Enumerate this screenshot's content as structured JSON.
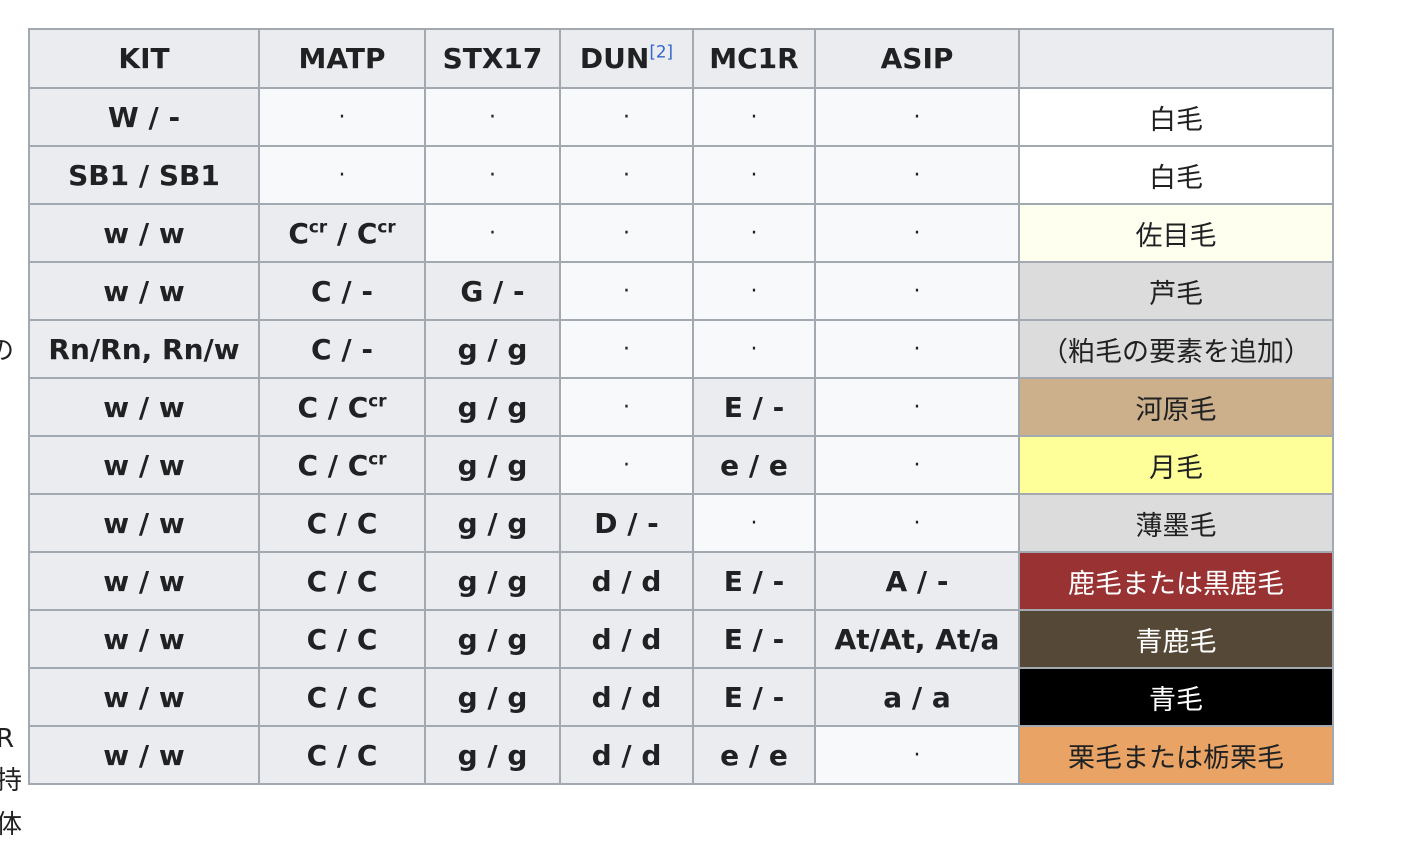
{
  "left_edge_fragments": [
    "の",
    "R",
    "持",
    "体"
  ],
  "table": {
    "headers": [
      {
        "base": "KIT",
        "sup": ""
      },
      {
        "base": "MATP",
        "sup": ""
      },
      {
        "base": "STX17",
        "sup": ""
      },
      {
        "base": "DUN",
        "sup": "[2]"
      },
      {
        "base": "MC1R",
        "sup": ""
      },
      {
        "base": "ASIP",
        "sup": ""
      },
      {
        "base": "",
        "sup": ""
      }
    ],
    "rows": [
      {
        "cells": [
          [
            "W / -"
          ],
          [
            "·"
          ],
          [
            "·"
          ],
          [
            "·"
          ],
          [
            "·"
          ],
          [
            "·"
          ]
        ],
        "color_name": "白毛",
        "bg": "#ffffff",
        "fg": "#202122"
      },
      {
        "cells": [
          [
            "SB1 / SB1"
          ],
          [
            "·"
          ],
          [
            "·"
          ],
          [
            "·"
          ],
          [
            "·"
          ],
          [
            "·"
          ]
        ],
        "color_name": "白毛",
        "bg": "#ffffff",
        "fg": "#202122"
      },
      {
        "cells": [
          [
            "w / w"
          ],
          [
            "C",
            "cr",
            " / C",
            "cr"
          ],
          [
            "·"
          ],
          [
            "·"
          ],
          [
            "·"
          ],
          [
            "·"
          ]
        ],
        "color_name": "佐目毛",
        "bg": "#fffff0",
        "fg": "#202122"
      },
      {
        "cells": [
          [
            "w / w"
          ],
          [
            "C / -"
          ],
          [
            "G / -"
          ],
          [
            "·"
          ],
          [
            "·"
          ],
          [
            "·"
          ]
        ],
        "color_name": "芦毛",
        "bg": "#dcdcdc",
        "fg": "#202122"
      },
      {
        "cells": [
          [
            "Rn/Rn, Rn/w"
          ],
          [
            "C / -"
          ],
          [
            "g / g"
          ],
          [
            "·"
          ],
          [
            "·"
          ],
          [
            "·"
          ]
        ],
        "color_name": "（粕毛の要素を追加）",
        "bg": "#dcdcdc",
        "fg": "#202122"
      },
      {
        "cells": [
          [
            "w / w"
          ],
          [
            "C / C",
            "cr"
          ],
          [
            "g / g"
          ],
          [
            "·"
          ],
          [
            "E / -"
          ],
          [
            "·"
          ]
        ],
        "color_name": "河原毛",
        "bg": "#ccb08c",
        "fg": "#202122"
      },
      {
        "cells": [
          [
            "w / w"
          ],
          [
            "C / C",
            "cr"
          ],
          [
            "g / g"
          ],
          [
            "·"
          ],
          [
            "e / e"
          ],
          [
            "·"
          ]
        ],
        "color_name": "月毛",
        "bg": "#ffff99",
        "fg": "#202122"
      },
      {
        "cells": [
          [
            "w / w"
          ],
          [
            "C / C"
          ],
          [
            "g / g"
          ],
          [
            "D / -"
          ],
          [
            "·"
          ],
          [
            "·"
          ]
        ],
        "color_name": "薄墨毛",
        "bg": "#dcdcdc",
        "fg": "#202122"
      },
      {
        "cells": [
          [
            "w / w"
          ],
          [
            "C / C"
          ],
          [
            "g / g"
          ],
          [
            "d / d"
          ],
          [
            "E / -"
          ],
          [
            "A / -"
          ]
        ],
        "color_name": "鹿毛または黒鹿毛",
        "bg": "#993333",
        "fg": "#ffffff"
      },
      {
        "cells": [
          [
            "w / w"
          ],
          [
            "C / C"
          ],
          [
            "g / g"
          ],
          [
            "d / d"
          ],
          [
            "E / -"
          ],
          [
            "At/At, At/a"
          ]
        ],
        "color_name": "青鹿毛",
        "bg": "#554837",
        "fg": "#ffffff"
      },
      {
        "cells": [
          [
            "w / w"
          ],
          [
            "C / C"
          ],
          [
            "g / g"
          ],
          [
            "d / d"
          ],
          [
            "E / -"
          ],
          [
            "a / a"
          ]
        ],
        "color_name": "青毛",
        "bg": "#000000",
        "fg": "#ffffff"
      },
      {
        "cells": [
          [
            "w / w"
          ],
          [
            "C / C"
          ],
          [
            "g / g"
          ],
          [
            "d / d"
          ],
          [
            "e / e"
          ],
          [
            "·"
          ]
        ],
        "color_name": "栗毛または栃栗毛",
        "bg": "#e8a365",
        "fg": "#202122"
      }
    ]
  }
}
